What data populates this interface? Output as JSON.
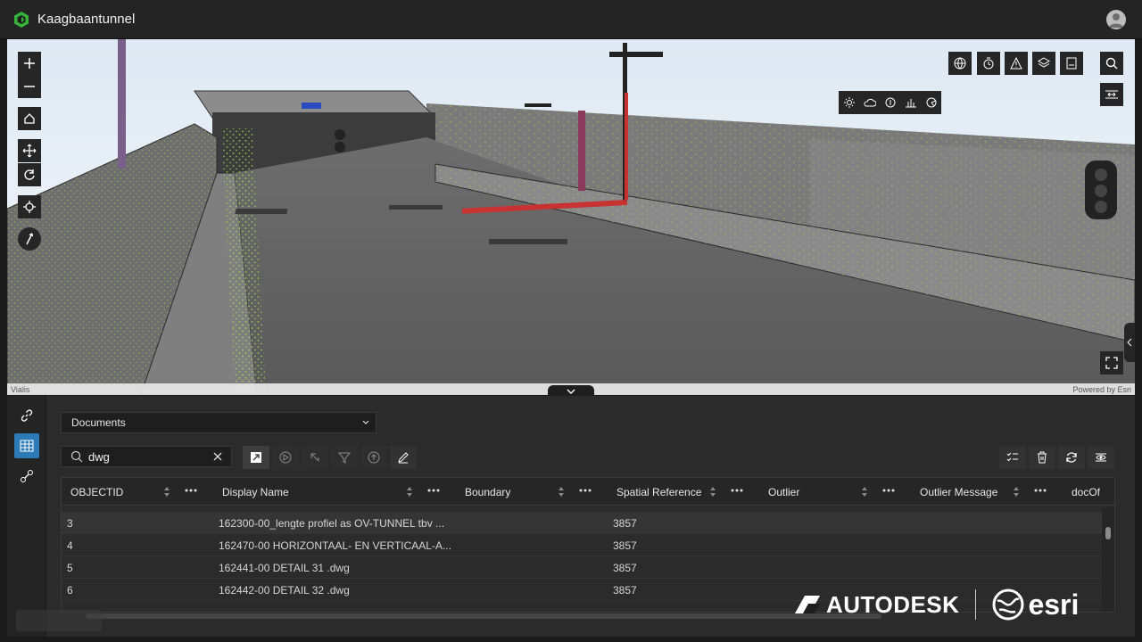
{
  "app": {
    "title": "Kaagbaantunnel"
  },
  "scene": {
    "attribution_left": "Vialis",
    "attribution_right": "Powered by Esri"
  },
  "layer_selector": {
    "value": "Documents"
  },
  "search": {
    "value": "dwg",
    "placeholder": ""
  },
  "table": {
    "columns": [
      "OBJECTID",
      "Display Name",
      "Boundary",
      "Spatial Reference",
      "Outlier",
      "Outlier Message",
      "docOf"
    ],
    "rows": [
      {
        "objectid": "3",
        "display_name": "162300-00_lengte profiel as OV-TUNNEL tbv ...",
        "boundary": "",
        "spatial_reference": "3857",
        "outlier": "",
        "outlier_message": ""
      },
      {
        "objectid": "4",
        "display_name": "162470-00 HORIZONTAAL- EN VERTICAAL-A...",
        "boundary": "",
        "spatial_reference": "3857",
        "outlier": "",
        "outlier_message": ""
      },
      {
        "objectid": "5",
        "display_name": "162441-00 DETAIL 31 .dwg",
        "boundary": "",
        "spatial_reference": "3857",
        "outlier": "",
        "outlier_message": ""
      },
      {
        "objectid": "6",
        "display_name": "162442-00 DETAIL 32 .dwg",
        "boundary": "",
        "spatial_reference": "3857",
        "outlier": "",
        "outlier_message": ""
      }
    ]
  },
  "branding": {
    "autodesk": "AUTODESK",
    "esri": "esri"
  },
  "colors": {
    "accent": "#2d7bb6",
    "point_cloud": "#9ccc3a",
    "logo_green": "#35b23a"
  }
}
